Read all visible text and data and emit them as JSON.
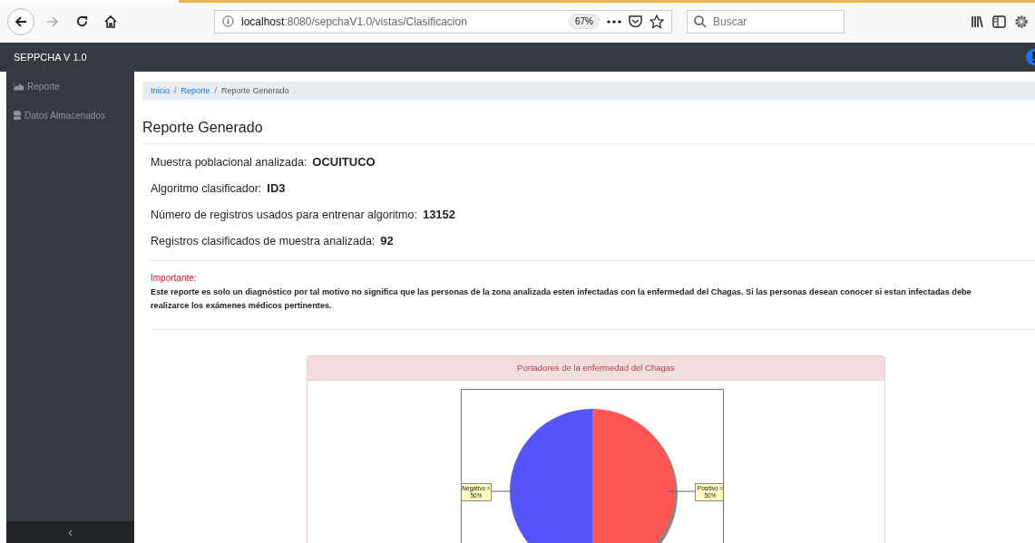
{
  "browser": {
    "url_host": "localhost",
    "url_rest": ":8080/sepchaV1.0/vistas/Clasificacion",
    "zoom": "67%",
    "search_placeholder": "Buscar"
  },
  "navbar": {
    "brand": "SEPPCHA V 1.0"
  },
  "sidebar": {
    "items": [
      {
        "label": "Reporte"
      },
      {
        "label": "Datos Almacenados"
      }
    ],
    "toggle": "‹"
  },
  "breadcrumb": [
    {
      "label": "Inicio",
      "kind": "link"
    },
    {
      "label": "/",
      "kind": "separator"
    },
    {
      "label": "Reporte",
      "kind": "link"
    },
    {
      "label": "/",
      "kind": "separator"
    },
    {
      "label": "Reporte Generado",
      "kind": "current"
    }
  ],
  "page_title": "Reporte Generado",
  "facts": [
    {
      "label": "Muestra poblacional analizada:",
      "value": "OCUITUCO"
    },
    {
      "label": "Algoritmo clasificador:",
      "value": "ID3"
    },
    {
      "label": "Número de registros usados para entrenar algoritmo:",
      "value": "13152"
    },
    {
      "label": "Registros clasificados de muestra analizada:",
      "value": "92"
    }
  ],
  "notice": {
    "heading": "Importante:",
    "lines": [
      "Este reporte es solo un diagnóstico por tal motivo no significa que las personas de la zona analizada esten infectadas con la enfermedad del Chagas. Si las personas desean conocer si estan infectadas debe",
      "realizarce los exámenes médicos pertinentes."
    ]
  },
  "chart_card": {
    "title": "Portadores de la enfermedad del Chagas",
    "chart_data": {
      "type": "pie",
      "values": [
        50,
        50
      ],
      "colors": [
        "#ff5555",
        "#5555ff"
      ],
      "value_labels": [
        "Positivo = 50%",
        "Negativo = 50%"
      ]
    }
  }
}
